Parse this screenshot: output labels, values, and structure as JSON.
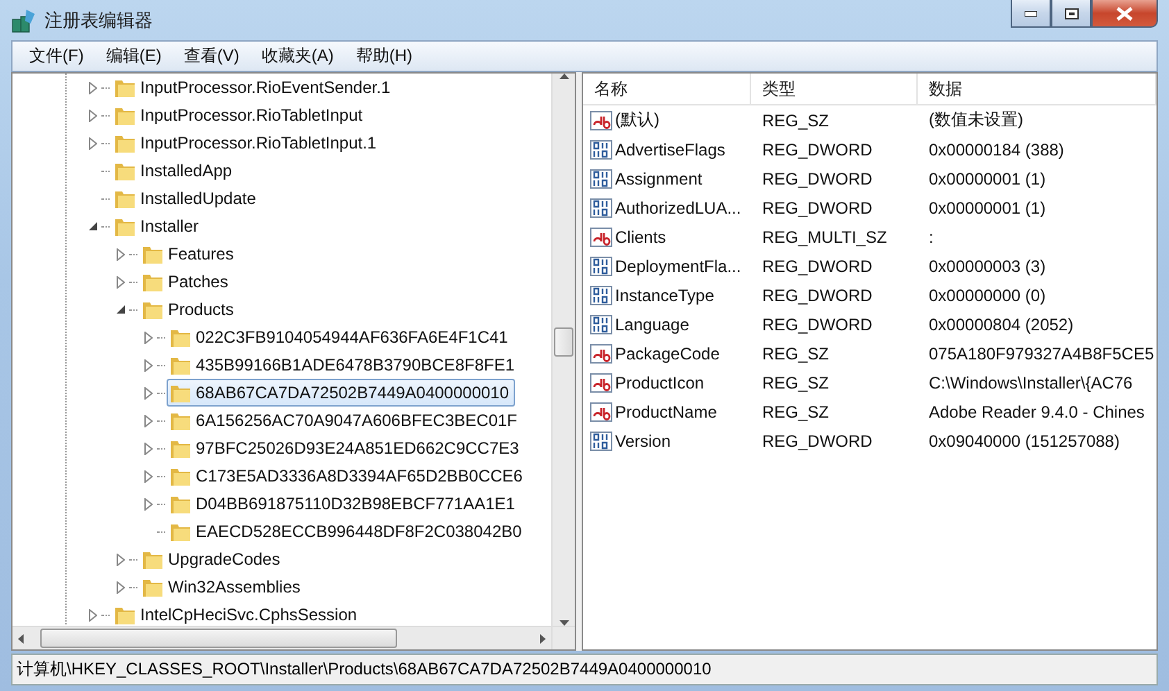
{
  "window": {
    "title": "注册表编辑器"
  },
  "menu": [
    "文件(F)",
    "编辑(E)",
    "查看(V)",
    "收藏夹(A)",
    "帮助(H)"
  ],
  "tree": [
    {
      "label": "InputProcessor.RioEventSender.1",
      "expanded": false,
      "selected": false
    },
    {
      "label": "InputProcessor.RioTabletInput",
      "expanded": false,
      "selected": false
    },
    {
      "label": "InputProcessor.RioTabletInput.1",
      "expanded": false,
      "selected": false
    },
    {
      "label": "InstalledApp",
      "selected": false
    },
    {
      "label": "InstalledUpdate",
      "selected": false
    },
    {
      "label": "Installer",
      "expanded": true,
      "selected": false,
      "children": [
        {
          "label": "Features",
          "expanded": false,
          "selected": false
        },
        {
          "label": "Patches",
          "expanded": false,
          "selected": false
        },
        {
          "label": "Products",
          "expanded": true,
          "selected": false,
          "children": [
            {
              "label": "022C3FB9104054944AF636FA6E4F1C41",
              "expanded": false,
              "selected": false
            },
            {
              "label": "435B99166B1ADE6478B3790BCE8F8FE1",
              "expanded": false,
              "selected": false
            },
            {
              "label": "68AB67CA7DA72502B7449A0400000010",
              "expanded": false,
              "selected": true
            },
            {
              "label": "6A156256AC70A9047A606BFEC3BEC01F",
              "expanded": false,
              "selected": false
            },
            {
              "label": "97BFC25026D93E24A851ED662C9CC7E3",
              "expanded": false,
              "selected": false
            },
            {
              "label": "C173E5AD3336A8D3394AF65D2BB0CCE6",
              "expanded": false,
              "selected": false
            },
            {
              "label": "D04BB691875110D32B98EBCF771AA1E1",
              "expanded": false,
              "selected": false
            },
            {
              "label": "EAECD528ECCB996448DF8F2C038042B0",
              "selected": false
            }
          ]
        },
        {
          "label": "UpgradeCodes",
          "expanded": false,
          "selected": false
        },
        {
          "label": "Win32Assemblies",
          "expanded": false,
          "selected": false
        }
      ]
    },
    {
      "label": "IntelCpHeciSvc.CphsSession",
      "expanded": false,
      "selected": false
    }
  ],
  "values": {
    "columns": [
      "名称",
      "类型",
      "数据"
    ],
    "rows": [
      {
        "kind": "string",
        "name": "(默认)",
        "type": "REG_SZ",
        "data": "(数值未设置)"
      },
      {
        "kind": "binary",
        "name": "AdvertiseFlags",
        "type": "REG_DWORD",
        "data": "0x00000184 (388)"
      },
      {
        "kind": "binary",
        "name": "Assignment",
        "type": "REG_DWORD",
        "data": "0x00000001 (1)"
      },
      {
        "kind": "binary",
        "name": "AuthorizedLUA...",
        "type": "REG_DWORD",
        "data": "0x00000001 (1)"
      },
      {
        "kind": "string",
        "name": "Clients",
        "type": "REG_MULTI_SZ",
        "data": ":"
      },
      {
        "kind": "binary",
        "name": "DeploymentFla...",
        "type": "REG_DWORD",
        "data": "0x00000003 (3)"
      },
      {
        "kind": "binary",
        "name": "InstanceType",
        "type": "REG_DWORD",
        "data": "0x00000000 (0)"
      },
      {
        "kind": "binary",
        "name": "Language",
        "type": "REG_DWORD",
        "data": "0x00000804 (2052)"
      },
      {
        "kind": "string",
        "name": "PackageCode",
        "type": "REG_SZ",
        "data": "075A180F979327A4B8F5CE5"
      },
      {
        "kind": "string",
        "name": "ProductIcon",
        "type": "REG_SZ",
        "data": "C:\\Windows\\Installer\\{AC76"
      },
      {
        "kind": "string",
        "name": "ProductName",
        "type": "REG_SZ",
        "data": "Adobe Reader 9.4.0 - Chines"
      },
      {
        "kind": "binary",
        "name": "Version",
        "type": "REG_DWORD",
        "data": "0x09040000 (151257088)"
      }
    ]
  },
  "status_bar": "计算机\\HKEY_CLASSES_ROOT\\Installer\\Products\\68AB67CA7DA72502B7449A0400000010"
}
